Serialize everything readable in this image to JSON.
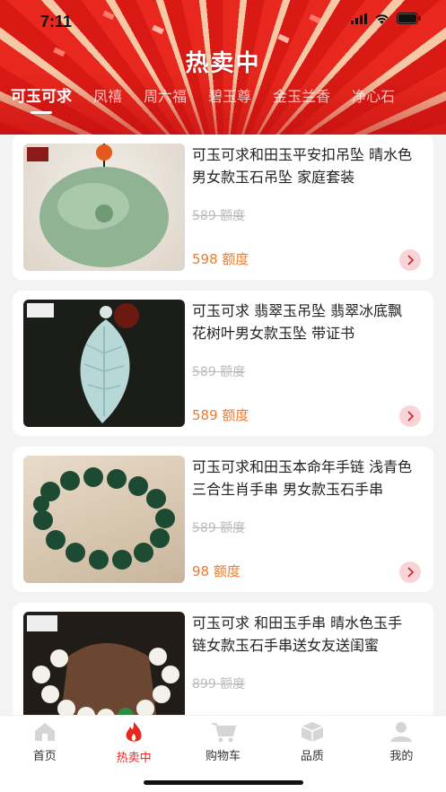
{
  "status": {
    "time": "7:11"
  },
  "header": {
    "title": "热卖中"
  },
  "tabs": [
    {
      "label": "可玉可求"
    },
    {
      "label": "凤禧"
    },
    {
      "label": "周六福"
    },
    {
      "label": "碧玉尊"
    },
    {
      "label": "金玉兰香"
    },
    {
      "label": "净心石"
    }
  ],
  "products": [
    {
      "name": "可玉可求和田玉平安扣吊坠 晴水色男女款玉石吊坠 家庭套装",
      "old_price": "589 额度",
      "price": "598 额度",
      "image": "jade-pendant-round"
    },
    {
      "name": "可玉可求 翡翠玉吊坠 翡翠冰底飘花树叶男女款玉坠 带证书",
      "old_price": "589 额度",
      "price": "589 额度",
      "image": "jade-leaf-pendant"
    },
    {
      "name": "可玉可求和田玉本命年手链 浅青色三合生肖手串 男女款玉石手串",
      "old_price": "589 额度",
      "price": "98 额度",
      "image": "green-bead-bracelet"
    },
    {
      "name": "可玉可求 和田玉手串 晴水色玉手链女款玉石手串送女友送闺蜜",
      "old_price": "899 额度",
      "price": "",
      "image": "white-bead-bracelet"
    }
  ],
  "tabbar": [
    {
      "label": "首页",
      "icon": "home-icon"
    },
    {
      "label": "热卖中",
      "icon": "flame-icon"
    },
    {
      "label": "购物车",
      "icon": "cart-icon"
    },
    {
      "label": "品质",
      "icon": "box-icon"
    },
    {
      "label": "我的",
      "icon": "user-icon"
    }
  ],
  "colors": {
    "accent": "#e8281e",
    "price": "#f07a2a",
    "hero": "#d91a14"
  }
}
